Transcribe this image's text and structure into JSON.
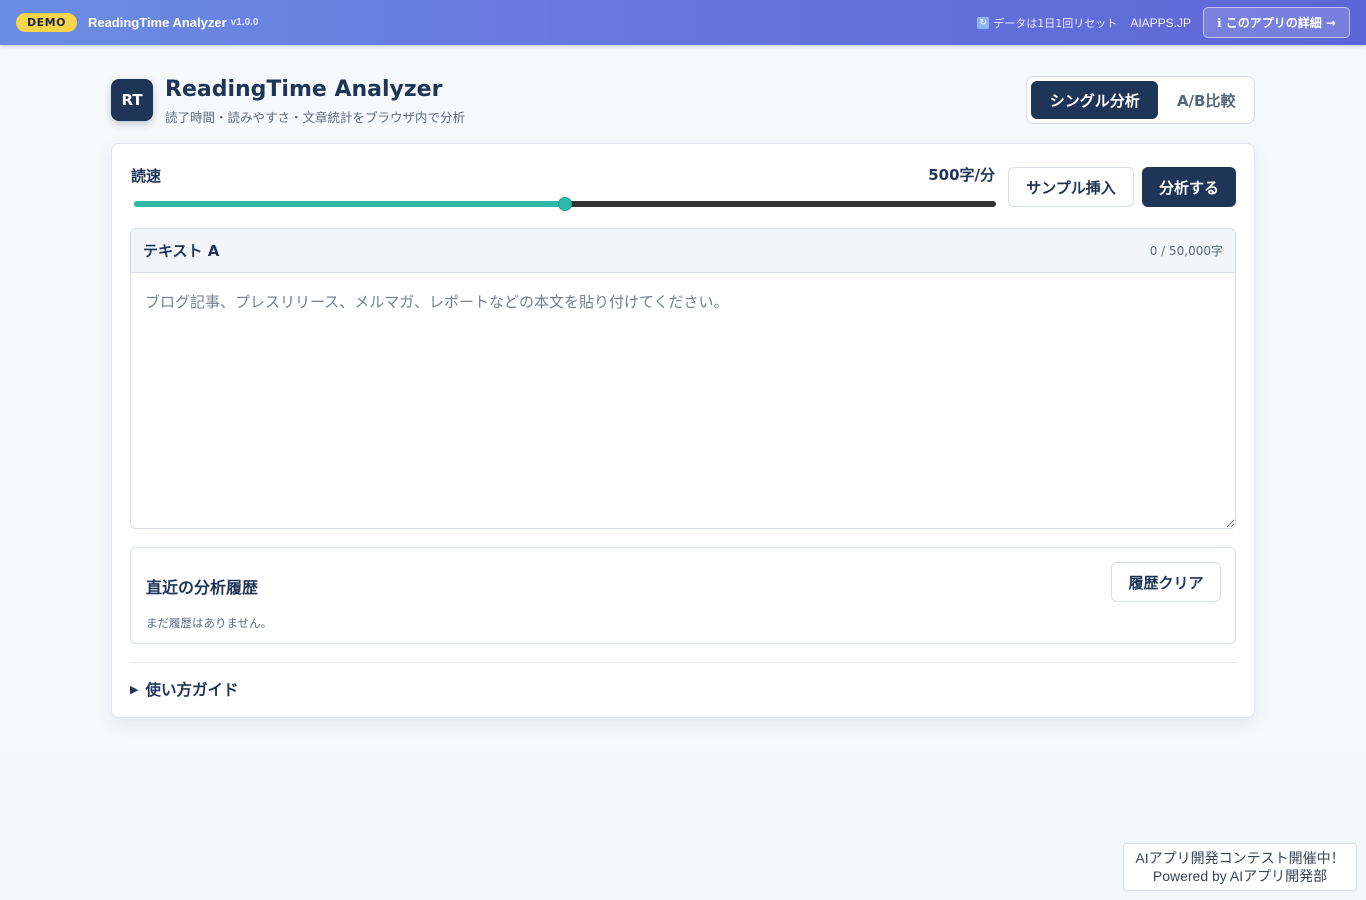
{
  "topbar": {
    "demo_badge": "DEMO",
    "app_name": "ReadingTime Analyzer",
    "version": "v1.0.0",
    "reset_note": "データは1日1回リセット",
    "reset_icon": "refresh-icon",
    "site_link": "AIAPPS.JP",
    "about_button": "ℹ このアプリの詳細 →"
  },
  "header": {
    "logo_text": "RT",
    "title": "ReadingTime Analyzer",
    "subtitle": "読了時間・読みやすさ・文章統計をブラウザ内で分析",
    "modes": [
      {
        "label": "シングル分析",
        "active": true
      },
      {
        "label": "A/B比較",
        "active": false
      }
    ]
  },
  "speed": {
    "label": "読速",
    "value_text": "500字/分",
    "value": 500,
    "fraction": 0.5
  },
  "actions": {
    "sample_button": "サンプル挿入",
    "analyze_button": "分析する"
  },
  "text_a": {
    "title": "テキスト A",
    "char_count": "0 / 50,000字",
    "placeholder": "ブログ記事、プレスリリース、メルマガ、レポートなどの本文を貼り付けてください。",
    "value": ""
  },
  "history": {
    "title": "直近の分析履歴",
    "clear_button": "履歴クリア",
    "empty_text": "まだ履歴はありません。"
  },
  "guide": {
    "arrow": "▶",
    "label": "使い方ガイド"
  },
  "footer_badge": {
    "line1": "AIアプリ開発コンテスト開催中！",
    "line2": "Powered by AIアプリ開発部"
  },
  "colors": {
    "primary": "#1e3558",
    "accent": "#2eb8a6",
    "badge": "#f7d44a"
  }
}
